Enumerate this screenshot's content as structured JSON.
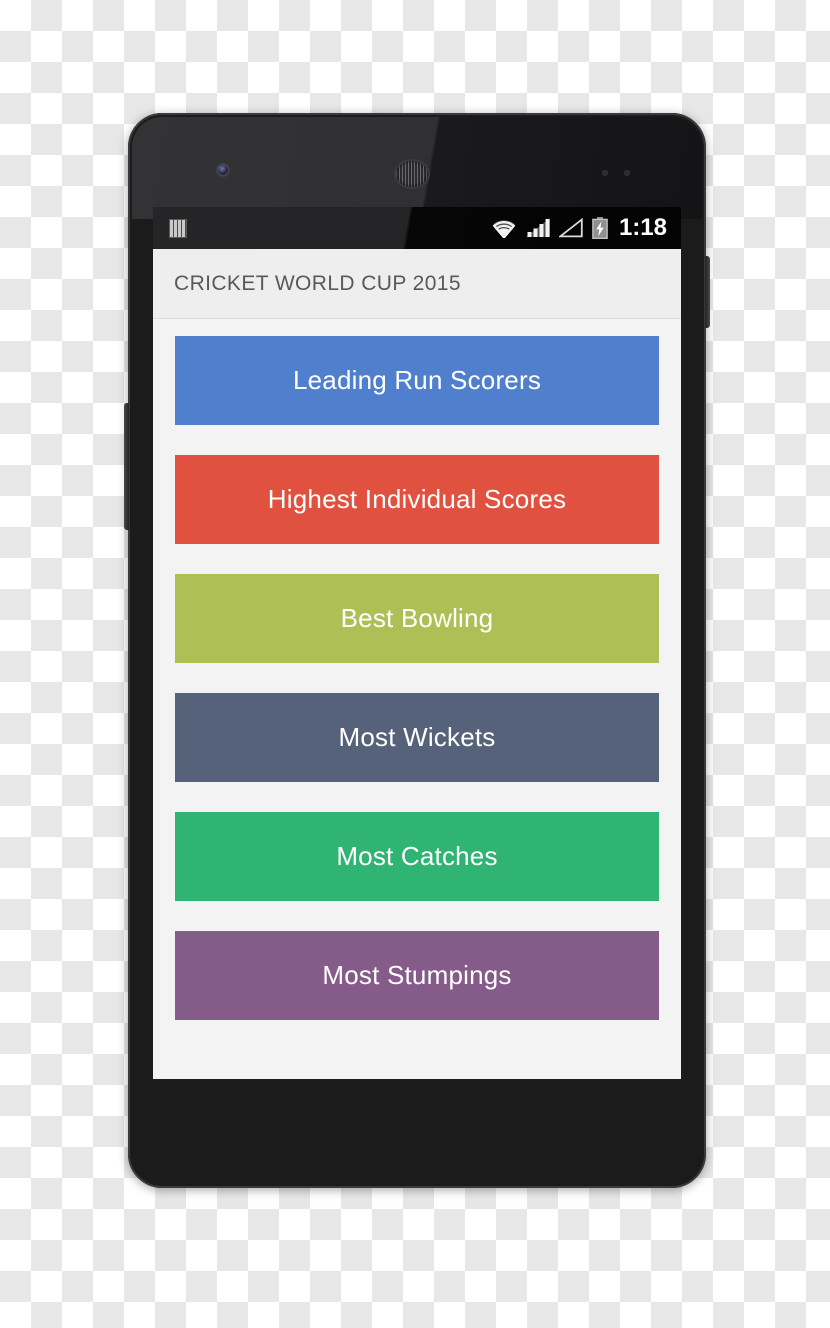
{
  "device": {
    "type": "android-smartphone",
    "frame_color": "#1b1b1b",
    "hardware": {
      "front_camera": "front-camera",
      "earpiece": "earpiece-speaker",
      "sensors": "proximity-sensors",
      "volume_rocker": "volume-rocker",
      "power_key": "power-button"
    }
  },
  "status_bar": {
    "notification_icon": "notification-bars-icon",
    "icons": [
      "wifi-icon",
      "cellular-signal-icon",
      "cellular-signal-empty-icon",
      "battery-charging-icon"
    ],
    "time": "1:18",
    "background": "#0a0a0b"
  },
  "app_bar": {
    "title": "CRICKET WORLD CUP 2015",
    "background": "#eeeeee",
    "text_color": "#595959"
  },
  "main": {
    "background": "#f3f3f3",
    "buttons": [
      {
        "label": "Leading Run Scorers",
        "color": "#4f7fcd",
        "name": "leading-run-scorers-button"
      },
      {
        "label": "Highest Individual Scores",
        "color": "#e0513f",
        "name": "highest-individual-scores-button"
      },
      {
        "label": "Best Bowling",
        "color": "#aec055",
        "name": "best-bowling-button"
      },
      {
        "label": "Most Wickets",
        "color": "#56627a",
        "name": "most-wickets-button"
      },
      {
        "label": "Most Catches",
        "color": "#30b474",
        "name": "most-catches-button"
      },
      {
        "label": "Most Stumpings",
        "color": "#855c89",
        "name": "most-stumpings-button"
      }
    ]
  }
}
